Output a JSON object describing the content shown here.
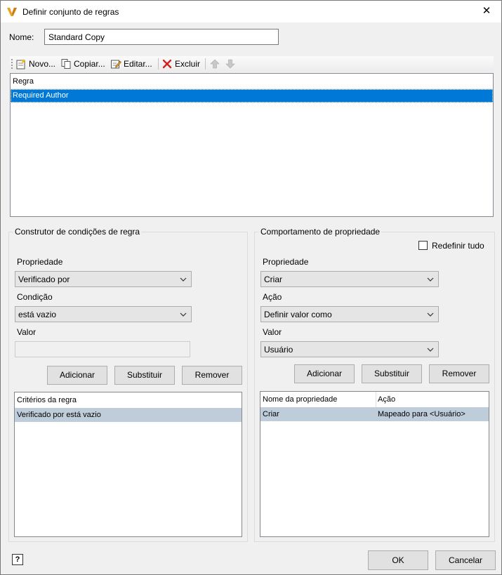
{
  "window": {
    "title": "Definir conjunto de regras",
    "close_glyph": "✕"
  },
  "name": {
    "label": "Nome:",
    "value": "Standard Copy"
  },
  "toolbar": {
    "new_label": "Novo...",
    "copy_label": "Copiar...",
    "edit_label": "Editar...",
    "delete_label": "Excluir"
  },
  "rules": {
    "header": "Regra",
    "items": [
      "Required Author"
    ]
  },
  "condition_builder": {
    "title": "Construtor de condições de regra",
    "property_label": "Propriedade",
    "property_value": "Verificado por",
    "condition_label": "Condição",
    "condition_value": "está vazio",
    "value_label": "Valor",
    "value_value": "",
    "add_label": "Adicionar",
    "replace_label": "Substituir",
    "remove_label": "Remover",
    "list_header": "Critérios da regra",
    "list_items": [
      "Verificado por está vazio"
    ]
  },
  "property_behavior": {
    "title": "Comportamento de propriedade",
    "reset_all_label": "Redefinir tudo",
    "reset_all_checked": false,
    "property_label": "Propriedade",
    "property_value": "Criar",
    "action_label": "Ação",
    "action_value": "Definir valor como",
    "value_label": "Valor",
    "value_value": "Usuário",
    "add_label": "Adicionar",
    "replace_label": "Substituir",
    "remove_label": "Remover",
    "columns": [
      "Nome da propriedade",
      "Ação"
    ],
    "rows": [
      {
        "property": "Criar",
        "action": "Mapeado para <Usuário>"
      }
    ]
  },
  "footer": {
    "help_glyph": "?",
    "ok_label": "OK",
    "cancel_label": "Cancelar"
  },
  "colors": {
    "selection": "#0078d7",
    "row_highlight": "#bfcddb",
    "logo": "#f0a020"
  }
}
